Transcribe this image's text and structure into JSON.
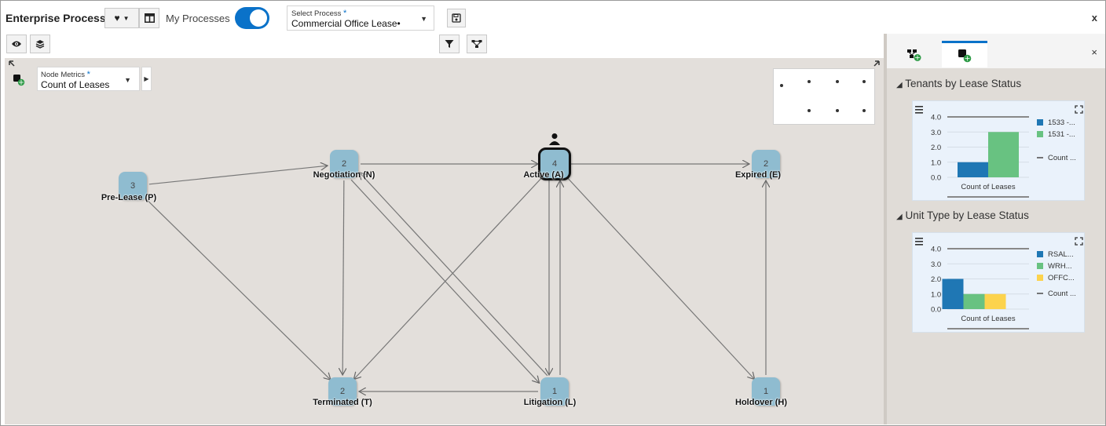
{
  "header": {
    "title": "Enterprise Process",
    "toggle_label": "My Processes",
    "select_label": "Select Process",
    "select_required": "*",
    "select_value": "Commercial Office Lease•",
    "close": "x"
  },
  "canvas": {
    "metric_label": "Node Metrics",
    "metric_required": "*",
    "metric_value": "Count of Leases"
  },
  "nodes": [
    {
      "id": "P",
      "count": "3",
      "label": "Pre-Lease (P)"
    },
    {
      "id": "N",
      "count": "2",
      "label": "Negotiation (N)"
    },
    {
      "id": "A",
      "count": "4",
      "label": "Active (A)"
    },
    {
      "id": "E",
      "count": "2",
      "label": "Expired (E)"
    },
    {
      "id": "T",
      "count": "2",
      "label": "Terminated (T)"
    },
    {
      "id": "L",
      "count": "1",
      "label": "Litigation (L)"
    },
    {
      "id": "H",
      "count": "1",
      "label": "Holdover (H)"
    }
  ],
  "edges": [
    [
      "P",
      "N"
    ],
    [
      "P",
      "T"
    ],
    [
      "N",
      "A"
    ],
    [
      "N",
      "T"
    ],
    [
      "N",
      "L"
    ],
    [
      "A",
      "E"
    ],
    [
      "A",
      "T"
    ],
    [
      "A",
      "L"
    ],
    [
      "A",
      "H"
    ],
    [
      "L",
      "N"
    ],
    [
      "L",
      "A"
    ],
    [
      "L",
      "T"
    ],
    [
      "H",
      "E"
    ]
  ],
  "side_panel": {
    "close": "×",
    "charts": [
      {
        "title": "Tenants by Lease Status",
        "chart_data": {
          "type": "bar",
          "categories": [
            "Count of Leases"
          ],
          "series": [
            {
              "name": "1533 -...",
              "values": [
                1
              ],
              "color": "#1f77b4"
            },
            {
              "name": "1531 -...",
              "values": [
                3
              ],
              "color": "#68c281"
            }
          ],
          "ylim": [
            0,
            4
          ],
          "yticks": [
            "4.0",
            "3.0",
            "2.0",
            "1.0",
            "0.0"
          ],
          "xlabel": "Count of Leases",
          "line_legend": "Count ..."
        }
      },
      {
        "title": "Unit Type by Lease Status",
        "chart_data": {
          "type": "bar",
          "categories": [
            "Count of Leases"
          ],
          "series": [
            {
              "name": "RSAL...",
              "values": [
                2
              ],
              "color": "#1f77b4"
            },
            {
              "name": "WRH...",
              "values": [
                1
              ],
              "color": "#68c281"
            },
            {
              "name": "OFFC...",
              "values": [
                1
              ],
              "color": "#fcd34d"
            }
          ],
          "ylim": [
            0,
            4
          ],
          "yticks": [
            "4.0",
            "3.0",
            "2.0",
            "1.0",
            "0.0"
          ],
          "xlabel": "Count of Leases",
          "line_legend": "Count ..."
        }
      }
    ]
  }
}
